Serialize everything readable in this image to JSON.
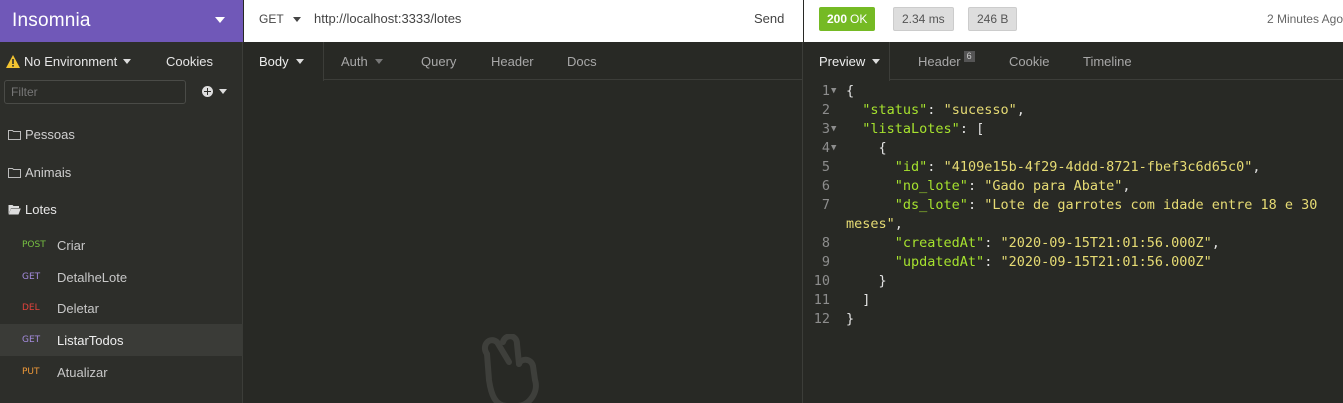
{
  "app": {
    "workspace_name": "Insomnia"
  },
  "sidebar": {
    "environment_label": "No Environment",
    "cookies_label": "Cookies",
    "filter_placeholder": "Filter",
    "folders": [
      {
        "name": "Pessoas",
        "expanded": false
      },
      {
        "name": "Animais",
        "expanded": false
      },
      {
        "name": "Lotes",
        "expanded": true
      }
    ],
    "requests": [
      {
        "method": "POST",
        "name": "Criar",
        "active": false
      },
      {
        "method": "GET",
        "name": "DetalheLote",
        "active": false
      },
      {
        "method": "DEL",
        "name": "Deletar",
        "active": false
      },
      {
        "method": "GET",
        "name": "ListarTodos",
        "active": true
      },
      {
        "method": "PUT",
        "name": "Atualizar",
        "active": false
      }
    ],
    "method_colors": {
      "POST": "#76c042",
      "GET": "#a58cdf",
      "DEL": "#e2423b",
      "PUT": "#f09a39"
    }
  },
  "request": {
    "method": "GET",
    "url": "http://localhost:3333/lotes",
    "send_label": "Send",
    "tabs": [
      {
        "label": "Body",
        "active": true
      },
      {
        "label": "Auth",
        "active": false
      },
      {
        "label": "Query",
        "active": false
      },
      {
        "label": "Header",
        "active": false
      },
      {
        "label": "Docs",
        "active": false
      }
    ]
  },
  "response": {
    "status_code": "200",
    "status_text": "OK",
    "time": "2.34 ms",
    "size": "246 B",
    "age": "2 Minutes Ago",
    "tabs": [
      {
        "label": "Preview",
        "active": true
      },
      {
        "label": "Header",
        "count": "6",
        "active": false
      },
      {
        "label": "Cookie",
        "active": false
      },
      {
        "label": "Timeline",
        "active": false
      }
    ],
    "body_lines": [
      {
        "num": "1",
        "fold": true,
        "tokens": [
          [
            "p",
            "{"
          ]
        ]
      },
      {
        "num": "2",
        "fold": false,
        "tokens": [
          [
            "p",
            "  "
          ],
          [
            "k",
            "\"status\""
          ],
          [
            "p",
            ": "
          ],
          [
            "s",
            "\"sucesso\""
          ],
          [
            "p",
            ","
          ]
        ]
      },
      {
        "num": "3",
        "fold": true,
        "tokens": [
          [
            "p",
            "  "
          ],
          [
            "k",
            "\"listaLotes\""
          ],
          [
            "p",
            ": ["
          ]
        ]
      },
      {
        "num": "4",
        "fold": true,
        "tokens": [
          [
            "p",
            "    {"
          ]
        ]
      },
      {
        "num": "5",
        "fold": false,
        "tokens": [
          [
            "p",
            "      "
          ],
          [
            "k",
            "\"id\""
          ],
          [
            "p",
            ": "
          ],
          [
            "s",
            "\"4109e15b-4f29-4ddd-8721-fbef3c6d65c0\""
          ],
          [
            "p",
            ","
          ]
        ]
      },
      {
        "num": "6",
        "fold": false,
        "tokens": [
          [
            "p",
            "      "
          ],
          [
            "k",
            "\"no_lote\""
          ],
          [
            "p",
            ": "
          ],
          [
            "s",
            "\"Gado para Abate\""
          ],
          [
            "p",
            ","
          ]
        ]
      },
      {
        "num": "7",
        "fold": false,
        "tokens": [
          [
            "p",
            "      "
          ],
          [
            "k",
            "\"ds_lote\""
          ],
          [
            "p",
            ": "
          ],
          [
            "s",
            "\"Lote de garrotes com idade entre 18 e 30"
          ]
        ]
      },
      {
        "num": "",
        "fold": false,
        "tokens": [
          [
            "s",
            "meses\""
          ],
          [
            "p",
            ","
          ]
        ]
      },
      {
        "num": "8",
        "fold": false,
        "tokens": [
          [
            "p",
            "      "
          ],
          [
            "k",
            "\"createdAt\""
          ],
          [
            "p",
            ": "
          ],
          [
            "s",
            "\"2020-09-15T21:01:56.000Z\""
          ],
          [
            "p",
            ","
          ]
        ]
      },
      {
        "num": "9",
        "fold": false,
        "tokens": [
          [
            "p",
            "      "
          ],
          [
            "k",
            "\"updatedAt\""
          ],
          [
            "p",
            ": "
          ],
          [
            "s",
            "\"2020-09-15T21:01:56.000Z\""
          ]
        ]
      },
      {
        "num": "10",
        "fold": false,
        "tokens": [
          [
            "p",
            "    }"
          ]
        ]
      },
      {
        "num": "11",
        "fold": false,
        "tokens": [
          [
            "p",
            "  ]"
          ]
        ]
      },
      {
        "num": "12",
        "fold": false,
        "tokens": [
          [
            "p",
            "}"
          ]
        ]
      }
    ]
  }
}
